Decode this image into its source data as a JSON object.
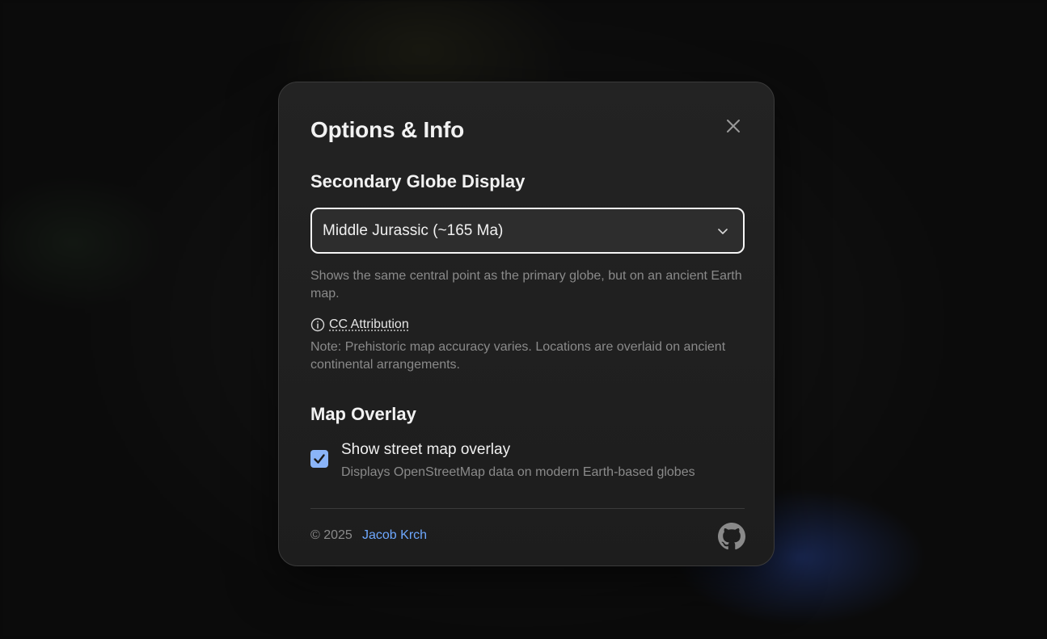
{
  "modal": {
    "title": "Options & Info",
    "close_icon": "close-icon"
  },
  "globe_section": {
    "title": "Secondary Globe Display",
    "select_value": "Middle Jurassic (~165 Ma)",
    "select_icon": "chevron-down-icon",
    "description": "Shows the same central point as the primary globe, but on an ancient Earth map.",
    "attribution_icon": "info-icon",
    "attribution_label": "CC Attribution",
    "note": "Note: Prehistoric map accuracy varies. Locations are overlaid on ancient continental arrangements."
  },
  "overlay_section": {
    "title": "Map Overlay",
    "checkbox_checked": true,
    "checkbox_label": "Show street map overlay",
    "checkbox_description": "Displays OpenStreetMap data on modern Earth-based globes"
  },
  "footer": {
    "copyright": "© 2025",
    "author": "Jacob Krch",
    "github_icon": "github-icon"
  },
  "colors": {
    "accent": "#6ea8fe",
    "checkbox": "#8ab4f8",
    "modal_bg": "#222222",
    "muted_text": "#8a8a8a"
  }
}
